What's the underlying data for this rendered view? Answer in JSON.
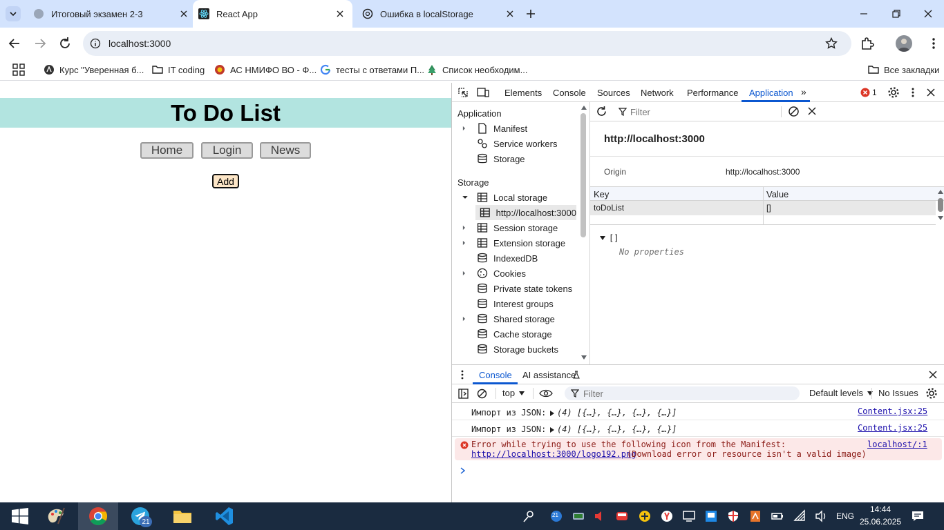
{
  "browser": {
    "tabs": [
      {
        "title": "Итоговый экзамен 2-3",
        "active": false
      },
      {
        "title": "React App",
        "active": true
      },
      {
        "title": "Ошибка в localStorage",
        "active": false
      }
    ],
    "url": "localhost:3000",
    "bookmarks": [
      {
        "label": "Курс \"Уверенная б..."
      },
      {
        "label": "IT coding"
      },
      {
        "label": "АС НМИФО ВО - Ф..."
      },
      {
        "label": "тесты с ответами П..."
      },
      {
        "label": "Список необходим..."
      }
    ],
    "all_bookmarks": "Все закладки"
  },
  "app": {
    "title": "To Do List",
    "nav": [
      "Home",
      "Login",
      "News"
    ],
    "add_label": "Add"
  },
  "devtools": {
    "tabs": [
      "Elements",
      "Console",
      "Sources",
      "Network",
      "Performance",
      "Application"
    ],
    "active_tab": "Application",
    "error_count": "1",
    "sidebar": {
      "application_header": "Application",
      "application_items": [
        "Manifest",
        "Service workers",
        "Storage"
      ],
      "storage_header": "Storage",
      "storage_items": {
        "local_storage": "Local storage",
        "local_origin": "http://localhost:3000",
        "session_storage": "Session storage",
        "extension_storage": "Extension storage",
        "indexeddb": "IndexedDB",
        "cookies": "Cookies",
        "private_state_tokens": "Private state tokens",
        "interest_groups": "Interest groups",
        "shared_storage": "Shared storage",
        "cache_storage": "Cache storage",
        "storage_buckets": "Storage buckets"
      }
    },
    "filter_placeholder": "Filter",
    "origin_title": "http://localhost:3000",
    "origin_label": "Origin",
    "origin_value": "http://localhost:3000",
    "table": {
      "key_header": "Key",
      "value_header": "Value",
      "rows": [
        {
          "key": "toDoList",
          "value": "[]"
        }
      ]
    },
    "preview": {
      "root": "[]",
      "empty": "No properties"
    }
  },
  "console": {
    "drawer_tabs": [
      "Console",
      "AI assistance"
    ],
    "context": "top",
    "filter_placeholder": "Filter",
    "levels": "Default levels",
    "issues": "No Issues",
    "messages": [
      {
        "text": "Импорт из JSON:",
        "obj": "(4) [{…}, {…}, {…}, {…}]",
        "source": "Content.jsx:25"
      },
      {
        "text": "Импорт из JSON:",
        "obj": "(4) [{…}, {…}, {…}, {…}]",
        "source": "Content.jsx:25"
      }
    ],
    "error": {
      "line1": "Error while trying to use the following icon from the Manifest:",
      "url": "http://localhost:3000/logo192.png",
      "line2": "(Download error or resource isn't a valid image)",
      "source": "localhost/:1"
    }
  },
  "taskbar": {
    "badge_telegram": "21",
    "tray_badge": "21",
    "lang": "ENG",
    "time": "14:44",
    "date": "25.06.2025"
  },
  "colors": {
    "tabstrip": "#d3e3fd",
    "header": "#b2e4e0",
    "accent": "#0b57d0",
    "error_bg": "#fce8e8",
    "taskbar": "#1a2b40"
  }
}
